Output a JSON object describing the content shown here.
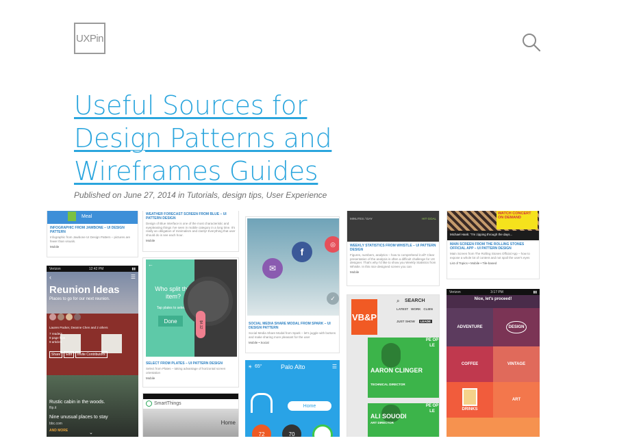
{
  "header": {
    "logo_text": "UXPin",
    "search_icon": "search-icon"
  },
  "article": {
    "title": "Useful Sources for Design Patterns and Wireframes Guides",
    "meta_prefix": "Published on June 27, 2014 in ",
    "categories": [
      "Tutorials",
      "design tips",
      "User Experience"
    ],
    "sep1": ", ",
    "sep2": ", "
  },
  "collage": {
    "col1": {
      "top_meal": "Meal",
      "top_title": "INFOGRAPHIC FROM JAWBONE – UI DESIGN PATTERN",
      "top_desc": "Infographic from Jawbone UI Design Pattern – pictures are fewer than visuals.",
      "top_tag": "Mobile",
      "carrier": "Verizon",
      "time": "12:42 PM",
      "heading": "Reunion Ideas",
      "sub": "Places to go for our next reunion.",
      "people": "Lauren Packer, Deanne Chen and 2 others",
      "stats": [
        "7 readers",
        "9 page flips",
        "9 articles"
      ],
      "actions": [
        "Share",
        "Edit",
        "Invite Contributors"
      ],
      "cabin": "Rustic cabin in the woods.",
      "cabin_src": "flip.it",
      "places": "Nine unusual places to stay",
      "places_src": "bbc.com",
      "more": "AND MORE"
    },
    "col2": {
      "top_title": "WEATHER FORECAST SCREEN FROM BLUE – UI PATTERN DESIGN",
      "top_desc": "Design of Blue Interface is one of the most characteristic and eyepleasing things I've seen in mobile category in a long time. It's really an obligation of minimalism and clarity! Everything that user should do is see each hour.",
      "top_tag": "Mobile",
      "question": "Who split this item?",
      "hint": "Tap plates to select.",
      "done": "Done",
      "price": "$4.12",
      "mid_title": "SELECT FROM PLATES – UI PATTERN DESIGN",
      "mid_desc": "Select from Plates – taking advantage of horizontal screen orientation",
      "mid_tag": "Mobile",
      "app_name": "SmartThings",
      "home": "Home"
    },
    "col3": {
      "card_title": "SOCIAL MEDIA SHARE MODAL FROM SPARK – UI DESIGN PATTERN",
      "card_desc": "Social Media Share Modal from Spark – let's juggle with buttons and make sharing more pleasant for the user",
      "card_tag": "Mobile • Social",
      "temp": "65°",
      "city": "Palo Alto",
      "home_btn": "Home",
      "dials": [
        "72",
        "70"
      ]
    },
    "col4": {
      "top_label": "MINUTES / DAY",
      "top_label2": "HIT GOAL",
      "top_title": "WEEKLY STATISTICS FROM WHISTLE – UI PATTERN DESIGN",
      "top_desc": "Figures, numbers, analytics – how to comprehend it all? Clear presentation of the analysis is often a difficult challenge for UX designer. That's why I'd like to show you Weekly Statistics from Whistle. In this nice designed screen you can",
      "top_tag": "Mobile",
      "vb": "VB&P",
      "search": "SEARCH",
      "tabs": [
        "LATEST",
        "WORK",
        "CLIEN"
      ],
      "tabs2": [
        "JUST SHOW",
        "LEADE"
      ],
      "person1": "AARON CLINGER",
      "role1": "TECHNICAL DIRECTOR",
      "person2": "ALI SOUODI",
      "role2": "ART DIRECTOR",
      "people_tag": "PE OP LE",
      "side_letters": [
        "AI",
        "BA"
      ]
    },
    "col5": {
      "banner": "WATCH CONCERT ON DEMAND",
      "tweet": "Michael Hank: \"I'm zipping through the days...",
      "top_title": "MAIN SCREEN FROM THE ROLLING STONES OFFICIAL APP – UI PATTERN DESIGN",
      "top_desc": "Main Screen from The Rolling Stones Official App – how to expose a whole lot of content and not spoil the user's eyes",
      "top_tag": "List of Topics • Mobile • Tile-based",
      "carrier": "Verizon",
      "time": "3:17 PM",
      "header": "Nice, let's proceed!",
      "tiles": [
        "ADVENTURE",
        "DESIGN",
        "COFFEE",
        "VINTAGE",
        "DRINKS",
        "ART"
      ]
    }
  }
}
